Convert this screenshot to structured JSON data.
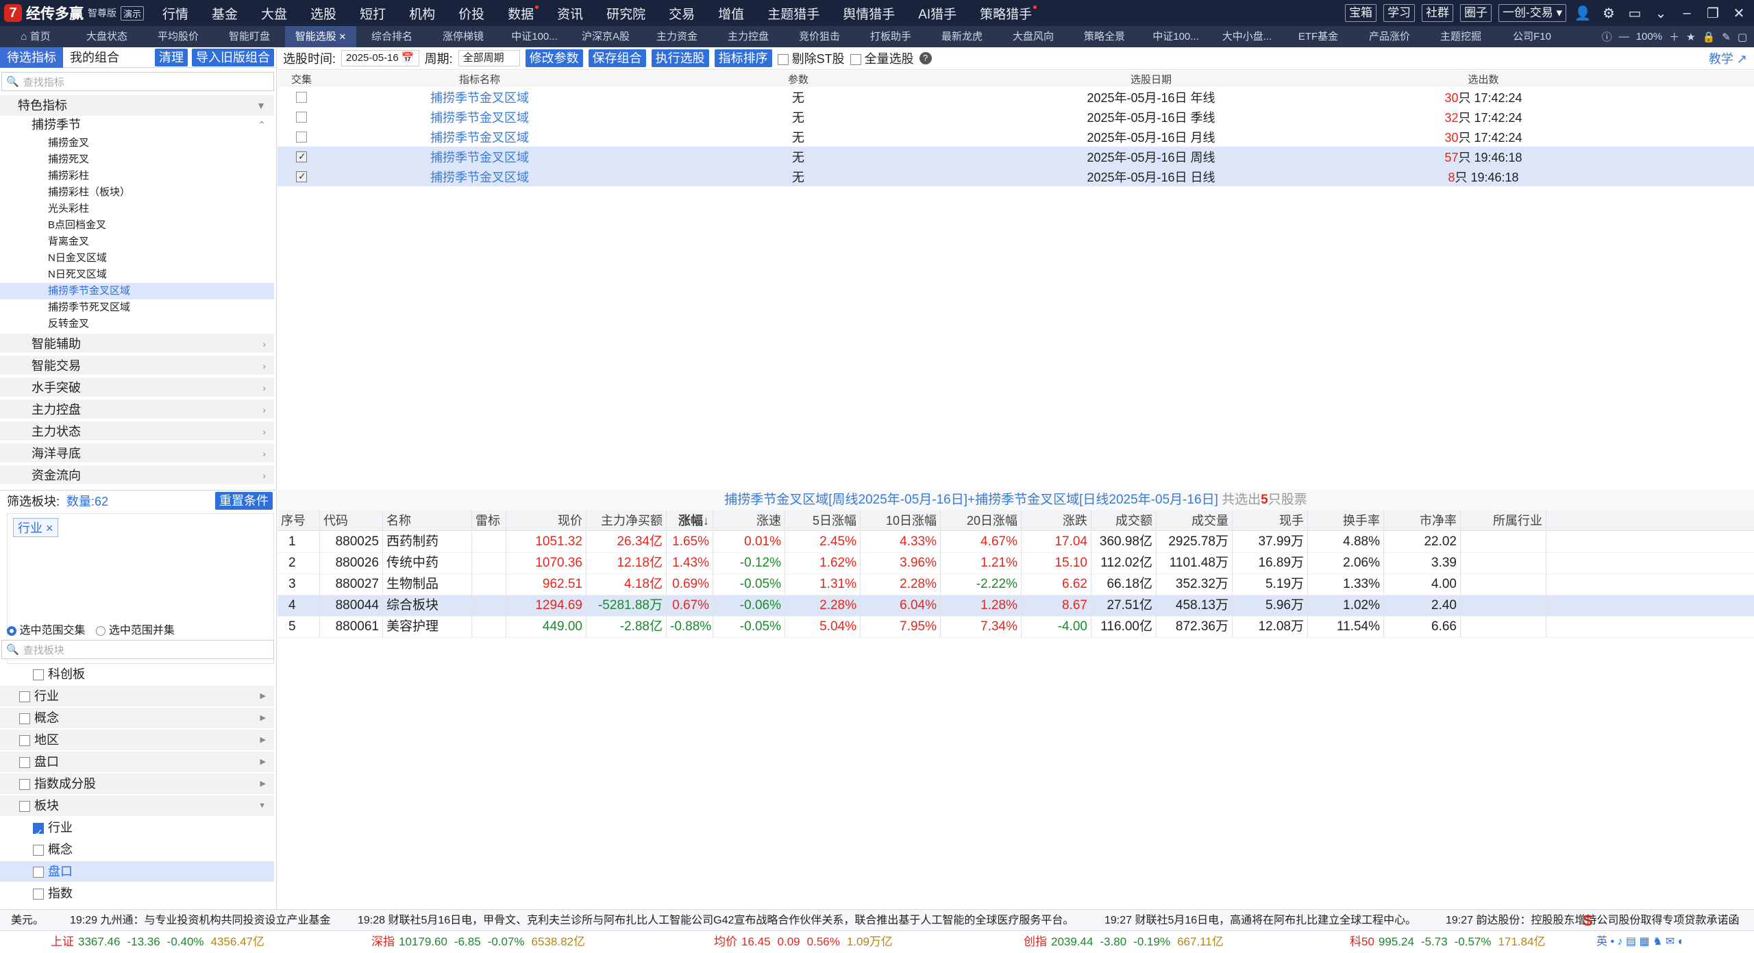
{
  "app": {
    "brand": "经传多赢",
    "edition": "智尊版",
    "demo": "演示"
  },
  "main_menu": [
    {
      "label": "行情"
    },
    {
      "label": "基金"
    },
    {
      "label": "大盘"
    },
    {
      "label": "选股"
    },
    {
      "label": "短打"
    },
    {
      "label": "机构"
    },
    {
      "label": "价投"
    },
    {
      "label": "数据",
      "hot": true
    },
    {
      "label": "资讯"
    },
    {
      "label": "研究院"
    },
    {
      "label": "交易"
    },
    {
      "label": "增值"
    },
    {
      "label": "主题猎手"
    },
    {
      "label": "舆情猎手"
    },
    {
      "label": "AI猎手"
    },
    {
      "label": "策略猎手",
      "hot": true
    }
  ],
  "top_right": {
    "buttons": [
      "宝箱",
      "学习",
      "社群",
      "圈子",
      "一创-交易"
    ]
  },
  "tabs": [
    "首页",
    "大盘状态",
    "平均股价",
    "智能盯盘",
    "智能选股",
    "综合排名",
    "涨停梯镜",
    "中证100...",
    "沪深京A股",
    "主力资金",
    "主力控盘",
    "竞价狙击",
    "打板助手",
    "最新龙虎",
    "大盘风向",
    "策略全景",
    "中证100...",
    "大中小盘...",
    "ETF基金",
    "产品涨价",
    "主题挖掘",
    "公司F10"
  ],
  "active_tab": "智能选股",
  "zoom": "100%",
  "left": {
    "tab_pending": "待选指标",
    "tab_combo": "我的组合",
    "clear_btn": "清理",
    "import_btn": "导入旧版组合",
    "search_placeholder": "查找指标",
    "tree": {
      "featured": "特色指标",
      "season": "捕捞季节",
      "leaves": [
        "捕捞金叉",
        "捕捞死叉",
        "捕捞彩柱",
        "捕捞彩柱（板块）",
        "光头彩柱",
        "B点回档金叉",
        "背离金叉",
        "N日金叉区域",
        "N日死叉区域",
        "捕捞季节金叉区域",
        "捕捞季节死叉区域",
        "反转金叉"
      ],
      "selected_leaf": 9,
      "groups": [
        "智能辅助",
        "智能交易",
        "水手突破",
        "主力控盘",
        "主力状态",
        "海洋寻底",
        "资金流向"
      ]
    },
    "filter": {
      "label": "筛选板块:",
      "count": "数量:62",
      "reset_btn": "重置条件",
      "tag": "行业"
    },
    "radio_intersect": "选中范围交集",
    "radio_union": "选中范围并集",
    "search2_placeholder": "查找板块",
    "board_tree": [
      {
        "label": "科创板",
        "checked": false,
        "level": 2
      },
      {
        "label": "行业",
        "checked": false,
        "level": 1,
        "arrow": "▶"
      },
      {
        "label": "概念",
        "checked": false,
        "level": 1,
        "arrow": "▶"
      },
      {
        "label": "地区",
        "checked": false,
        "level": 1,
        "arrow": "▶"
      },
      {
        "label": "盘口",
        "checked": false,
        "level": 1,
        "arrow": "▶"
      },
      {
        "label": "指数成分股",
        "checked": false,
        "level": 1,
        "arrow": "▶"
      },
      {
        "label": "板块",
        "checked": false,
        "level": 1,
        "arrow": "▼"
      },
      {
        "label": "行业",
        "checked": true,
        "level": 2
      },
      {
        "label": "概念",
        "checked": false,
        "level": 2
      },
      {
        "label": "盘口",
        "checked": false,
        "level": 2,
        "selected": true
      },
      {
        "label": "指数",
        "checked": false,
        "level": 2
      }
    ]
  },
  "toolbar": {
    "date_label": "选股时间:",
    "date_value": "2025-05-16",
    "period_label": "周期:",
    "period_value": "全部周期",
    "modify_btn": "修改参数",
    "save_btn": "保存组合",
    "run_btn": "执行选股",
    "sort_btn": "指标排序",
    "exclude_st": "剔除ST股",
    "full_select": "全量选股",
    "teach": "教学"
  },
  "upper_table": {
    "headers": [
      "交集",
      "指标名称",
      "参数",
      "选股日期",
      "选出数"
    ],
    "rows": [
      {
        "checked": false,
        "name": "捕捞季节金叉区域",
        "param": "无",
        "date": "2025年-05月-16日 年线",
        "count": "30",
        "time": "只 17:42:24",
        "sel": false
      },
      {
        "checked": false,
        "name": "捕捞季节金叉区域",
        "param": "无",
        "date": "2025年-05月-16日 季线",
        "count": "32",
        "time": "只 17:42:24",
        "sel": false
      },
      {
        "checked": false,
        "name": "捕捞季节金叉区域",
        "param": "无",
        "date": "2025年-05月-16日 月线",
        "count": "30",
        "time": "只 17:42:24",
        "sel": false
      },
      {
        "checked": true,
        "name": "捕捞季节金叉区域",
        "param": "无",
        "date": "2025年-05月-16日 周线",
        "count": "57",
        "time": "只 19:46:18",
        "sel": true
      },
      {
        "checked": true,
        "name": "捕捞季节金叉区域",
        "param": "无",
        "date": "2025年-05月-16日 日线",
        "count": "8",
        "time": "只 19:46:18",
        "sel": true
      }
    ]
  },
  "result_title": {
    "text": "捕捞季节金叉区域[周线2025年-05月-16日]+捕捞季节金叉区域[日线2025年-05月-16日]",
    "prefix": "共选出",
    "count": "5",
    "suffix": "只股票"
  },
  "lower_table": {
    "headers": [
      "序号",
      "代码",
      "名称",
      "雷标",
      "现价",
      "主力净买额",
      "涨幅↓",
      "涨速",
      "5日涨幅",
      "10日涨幅",
      "20日涨幅",
      "涨跌",
      "成交额",
      "成交量",
      "现手",
      "换手率",
      "市净率",
      "所属行业"
    ],
    "rows": [
      {
        "no": "1",
        "code": "880025",
        "name": "西药制药",
        "price": "1051.32",
        "net": "26.34亿",
        "chg": "1.65%",
        "speed": "0.01%",
        "d5": "2.45%",
        "d10": "4.33%",
        "d20": "4.67%",
        "diff": "17.04",
        "amount": "360.98亿",
        "vol": "2925.78万",
        "hand": "37.99万",
        "turn": "4.88%",
        "pb": "22.02",
        "sel": false
      },
      {
        "no": "2",
        "code": "880026",
        "name": "传统中药",
        "price": "1070.36",
        "net": "12.18亿",
        "chg": "1.43%",
        "speed": "-0.12%",
        "d5": "1.62%",
        "d10": "3.96%",
        "d20": "1.21%",
        "diff": "15.10",
        "amount": "112.02亿",
        "vol": "1101.48万",
        "hand": "16.89万",
        "turn": "2.06%",
        "pb": "3.39",
        "sel": false
      },
      {
        "no": "3",
        "code": "880027",
        "name": "生物制品",
        "price": "962.51",
        "net": "4.18亿",
        "chg": "0.69%",
        "speed": "-0.05%",
        "d5": "1.31%",
        "d10": "2.28%",
        "d20": "-2.22%",
        "diff": "6.62",
        "amount": "66.18亿",
        "vol": "352.32万",
        "hand": "5.19万",
        "turn": "1.33%",
        "pb": "4.00",
        "sel": false
      },
      {
        "no": "4",
        "code": "880044",
        "name": "综合板块",
        "price": "1294.69",
        "net": "-5281.88万",
        "chg": "0.67%",
        "speed": "-0.06%",
        "d5": "2.28%",
        "d10": "6.04%",
        "d20": "1.28%",
        "diff": "8.67",
        "amount": "27.51亿",
        "vol": "458.13万",
        "hand": "5.96万",
        "turn": "1.02%",
        "pb": "2.40",
        "sel": true
      },
      {
        "no": "5",
        "code": "880061",
        "name": "美容护理",
        "price": "449.00",
        "net": "-2.88亿",
        "chg": "-0.88%",
        "speed": "-0.05%",
        "d5": "5.04%",
        "d10": "7.95%",
        "d20": "7.34%",
        "diff": "-4.00",
        "amount": "116.00亿",
        "vol": "872.36万",
        "hand": "12.08万",
        "turn": "11.54%",
        "pb": "6.66",
        "sel": false
      }
    ]
  },
  "news": [
    "美元。",
    "19:29 九州通：与专业投资机构共同投资设立产业基金",
    "19:28 财联社5月16日电，甲骨文、克利夫兰诊所与阿布扎比人工智能公司G42宣布战略合作伙伴关系，联合推出基于人工智能的全球医疗服务平台。",
    "19:27 财联社5月16日电，高通将在阿布扎比建立全球工程中心。",
    "19:27 韵达股份：控股股东增持公司股份取得专项贷款承诺函"
  ],
  "indices": [
    {
      "name": "上证",
      "value": "3367.46",
      "diff": "-13.36",
      "pct": "-0.40%",
      "amount": "4356.47亿"
    },
    {
      "name": "深指",
      "value": "10179.60",
      "diff": "-6.85",
      "pct": "-0.07%",
      "amount": "6538.82亿"
    },
    {
      "name": "均价",
      "value": "16.45",
      "diff": "0.09",
      "pct": "0.56%",
      "amount": "1.09万亿"
    },
    {
      "name": "创指",
      "value": "2039.44",
      "diff": "-3.80",
      "pct": "-0.19%",
      "amount": "667.11亿"
    },
    {
      "name": "科50",
      "value": "995.24",
      "diff": "-5.73",
      "pct": "-0.57%",
      "amount": "171.84亿"
    }
  ],
  "colors": {
    "accent": "#2f6fdb",
    "up": "#e8251a",
    "down": "#1a8a2a",
    "titlebar": "#19233b",
    "tabbar": "#2a3550"
  }
}
